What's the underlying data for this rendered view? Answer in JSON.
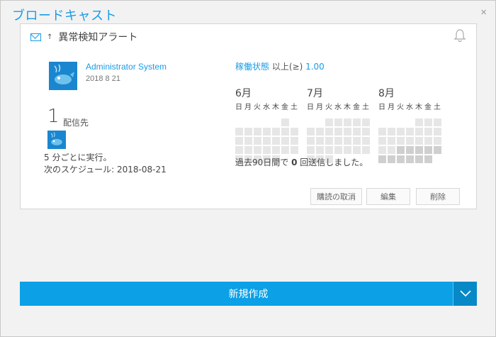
{
  "dialog": {
    "title": "ブロードキャスト",
    "close": "×"
  },
  "card": {
    "icon": "mail-icon",
    "arrow": "↑",
    "title": "異常検知アラート",
    "bell_icon": "bell-icon",
    "author": {
      "name": "Administrator System",
      "date": "2018 8 21"
    },
    "recipients": {
      "count": "1",
      "label": "配信先"
    },
    "run": {
      "every": "5 分ごとに実行。",
      "next": "次のスケジュール: 2018-08-21"
    },
    "condition": {
      "metric": "稼働状態",
      "op": " 以上(≥) ",
      "value": "1.00"
    },
    "calendar": {
      "weekdays": [
        "日",
        "月",
        "火",
        "水",
        "木",
        "金",
        "土"
      ],
      "months": [
        {
          "label": "6月",
          "cells": [
            0,
            0,
            0,
            0,
            0,
            1,
            0,
            1,
            1,
            1,
            1,
            1,
            1,
            1,
            1,
            1,
            1,
            1,
            1,
            1,
            1,
            1,
            1,
            1,
            1,
            1,
            1,
            1,
            1,
            1,
            1,
            1,
            1,
            0,
            0
          ]
        },
        {
          "label": "7月",
          "cells": [
            0,
            0,
            1,
            1,
            1,
            1,
            1,
            1,
            1,
            1,
            1,
            1,
            1,
            1,
            1,
            1,
            1,
            1,
            1,
            1,
            1,
            1,
            1,
            1,
            1,
            1,
            1,
            1,
            1,
            1,
            1,
            0,
            0,
            0,
            0
          ]
        },
        {
          "label": "8月",
          "cells": [
            0,
            0,
            0,
            0,
            1,
            1,
            1,
            1,
            1,
            1,
            1,
            1,
            1,
            1,
            1,
            1,
            1,
            1,
            1,
            1,
            1,
            1,
            1,
            2,
            2,
            2,
            2,
            2,
            2,
            2,
            2,
            2,
            2,
            2,
            0
          ]
        }
      ]
    },
    "summary": {
      "pre": "過去90日間で ",
      "count": "0",
      "post": " 回送信しました。"
    },
    "buttons": {
      "unsubscribe": "購読の取消",
      "edit": "編集",
      "delete": "削除"
    }
  },
  "footer": {
    "new_label": "新規作成"
  }
}
